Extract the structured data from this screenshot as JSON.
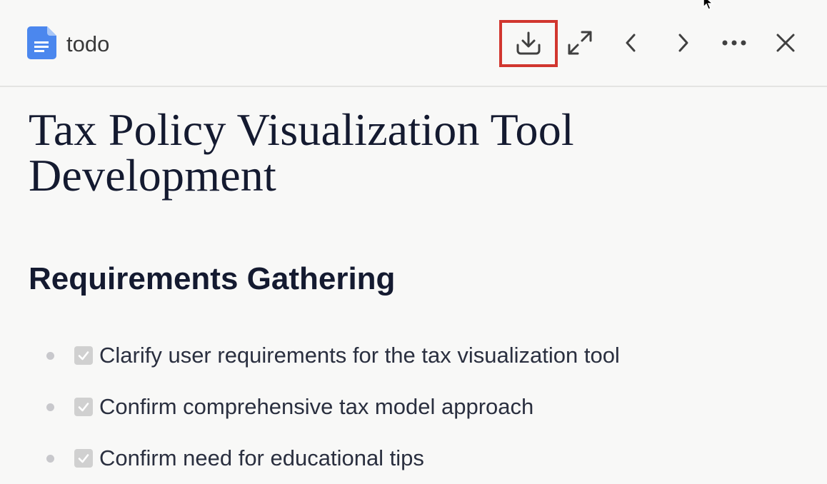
{
  "header": {
    "doc_title": "todo",
    "icons": {
      "doc": "google-docs-icon",
      "download": "download-icon",
      "expand": "expand-icon",
      "prev": "chevron-left-icon",
      "next": "chevron-right-icon",
      "more": "more-horizontal-icon",
      "close": "close-icon"
    },
    "highlight_color": "#d1362f",
    "doc_icon_color": "#4b87ee"
  },
  "document": {
    "title": "Tax Policy Visualization Tool Development",
    "sections": [
      {
        "heading": "Requirements Gathering",
        "tasks": [
          {
            "text": "Clarify user requirements for the tax visualization tool",
            "checked": true
          },
          {
            "text": "Confirm comprehensive tax model approach",
            "checked": true
          },
          {
            "text": "Confirm need for educational tips",
            "checked": true
          }
        ]
      }
    ]
  }
}
